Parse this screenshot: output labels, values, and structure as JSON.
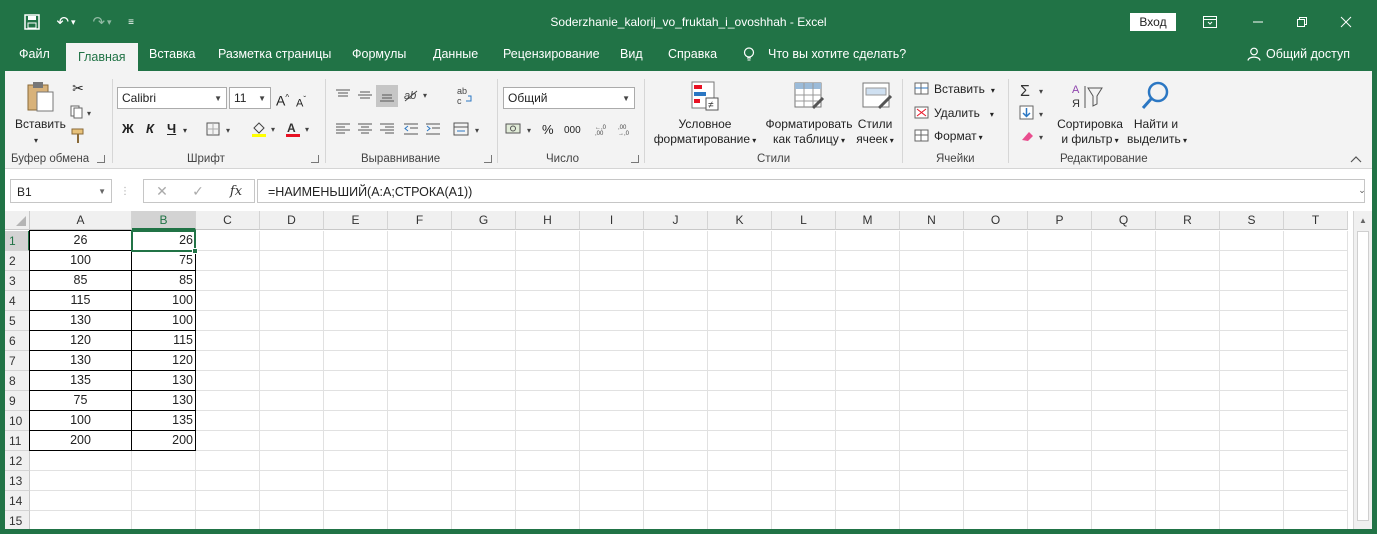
{
  "title_bar": {
    "document_title": "Soderzhanie_kalorij_vo_fruktah_i_ovoshhah  -  Excel",
    "login_label": "Вход",
    "icons": [
      "save-icon",
      "undo-icon",
      "redo-icon",
      "customize-quick-access-icon"
    ]
  },
  "menu": {
    "tabs": [
      "Файл",
      "Главная",
      "Вставка",
      "Разметка страницы",
      "Формулы",
      "Данные",
      "Рецензирование",
      "Вид",
      "Справка",
      "Что вы хотите сделать?"
    ],
    "active_tab": "Главная",
    "share_label": "Общий доступ"
  },
  "ribbon": {
    "clipboard": {
      "paste_label": "Вставить",
      "group_label": "Буфер обмена"
    },
    "font": {
      "font_name": "Calibri",
      "font_size": "11",
      "bold": "Ж",
      "italic": "К",
      "underline": "Ч",
      "group_label": "Шрифт",
      "increase": "A",
      "decrease": "A"
    },
    "alignment": {
      "group_label": "Выравнивание"
    },
    "number": {
      "format": "Общий",
      "percent": "%",
      "thousands": "000",
      "group_label": "Число"
    },
    "styles": {
      "conditional_line1": "Условное",
      "conditional_line2": "форматирование",
      "format_table_line1": "Форматировать",
      "format_table_line2": "как таблицу",
      "cell_styles_line1": "Стили",
      "cell_styles_line2": "ячеек",
      "group_label": "Стили"
    },
    "cells": {
      "insert": "Вставить",
      "delete": "Удалить",
      "format": "Формат",
      "group_label": "Ячейки"
    },
    "editing": {
      "sort_line1": "Сортировка",
      "sort_line2": "и фильтр",
      "find_line1": "Найти и",
      "find_line2": "выделить",
      "group_label": "Редактирование"
    }
  },
  "formula_bar": {
    "name_box": "B1",
    "fx": "fx",
    "formula": "=НАИМЕНЬШИЙ(A:A;СТРОКА(A1))"
  },
  "sheet": {
    "columns": [
      "A",
      "B",
      "C",
      "D",
      "E",
      "F",
      "G",
      "H",
      "I",
      "J",
      "K",
      "L",
      "M",
      "N",
      "O",
      "P",
      "Q",
      "R",
      "S",
      "T"
    ],
    "rows": [
      "1",
      "2",
      "3",
      "4",
      "5",
      "6",
      "7",
      "8",
      "9",
      "10",
      "11",
      "12",
      "13",
      "14",
      "15"
    ],
    "selected_cell": "B1",
    "col_a": [
      "26",
      "100",
      "85",
      "115",
      "130",
      "120",
      "130",
      "135",
      "75",
      "100",
      "200"
    ],
    "col_b": [
      "26",
      "75",
      "85",
      "100",
      "100",
      "115",
      "120",
      "130",
      "130",
      "135",
      "200"
    ]
  },
  "colors": {
    "accent": "#217346"
  }
}
